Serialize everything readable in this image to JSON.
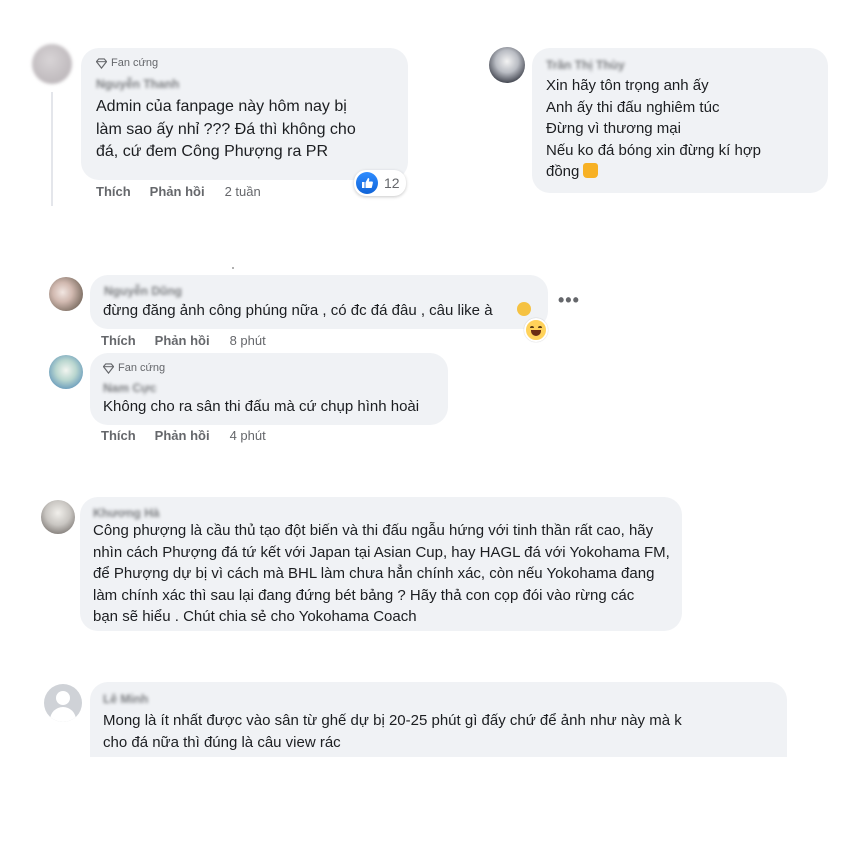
{
  "comments": [
    {
      "badge": "Fan cứng",
      "name": "Nguyễn Thanh",
      "lines": [
        "Admin của fanpage này hôm nay bị",
        "làm sao ấy nhỉ ??? Đá thì không cho",
        "đá, cứ đem Công Phượng ra PR"
      ],
      "like_label": "Thích",
      "reply_label": "Phản hồi",
      "time": "2 tuần",
      "reaction_count": "12"
    },
    {
      "name": "Trần Thị Thùy",
      "lines": [
        "Xin hãy tôn trọng anh ấy",
        "Anh ấy thi đấu nghiêm túc",
        "Đừng vì thương mại",
        "Nếu ko đá bóng xin đừng kí hợp",
        "đồng"
      ]
    },
    {
      "name": "Nguyễn Dũng",
      "lines": [
        "đừng đăng ảnh công phúng nữa , có đc đá đâu , câu like à"
      ],
      "like_label": "Thích",
      "reply_label": "Phản hồi",
      "time": "8 phút"
    },
    {
      "badge": "Fan cứng",
      "name": "Nam Cực",
      "lines": [
        "Không cho ra sân thi đấu mà cứ chụp hình hoài"
      ],
      "like_label": "Thích",
      "reply_label": "Phản hồi",
      "time": "4 phút"
    },
    {
      "name": "Khương Hà",
      "lines": [
        "Công phượng là cầu thủ tạo đột biến và thi đấu ngẫu hứng với tinh thần rất cao, hãy",
        "nhìn cách Phượng đá tứ kết với Japan tại Asian Cup, hay HAGL đá với Yokohama FM,",
        "để Phượng dự bị vì cách mà BHL làm chưa hẳn chính xác, còn nếu Yokohama đang",
        "làm chính xác thì sau lại đang đứng bét bảng ? Hãy thả con cọp đói vào rừng các",
        "bạn sẽ hiểu . Chút chia sẻ cho Yokohama Coach"
      ]
    },
    {
      "name": "Lê Minh",
      "lines": [
        "Mong là ít nhất được vào sân từ ghế dự bị 20-25 phút gì đấy chứ để ảnh như này mà k",
        "cho đá nữa thì đúng là câu view rác"
      ]
    }
  ],
  "icons": {
    "badge": "diamond-icon",
    "like_reaction": "like-icon",
    "haha_reaction": "haha-icon",
    "more": "more-options-icon",
    "thumbs_up_emoji": "thumbs-up-emoji-icon"
  },
  "more_label": "•••",
  "colors": {
    "bubble": "#f0f2f5",
    "meta": "#65676b",
    "like_blue": "#1877f2"
  }
}
